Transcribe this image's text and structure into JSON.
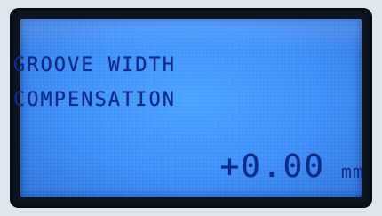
{
  "display": {
    "line1": "GROOVE WIDTH",
    "line2": "COMPENSATION",
    "value": "+0.00",
    "unit": "mm"
  },
  "colors": {
    "backlight": "#3d8ef8",
    "segment_text": "#0f2a8a",
    "bezel": "#0b1420"
  }
}
